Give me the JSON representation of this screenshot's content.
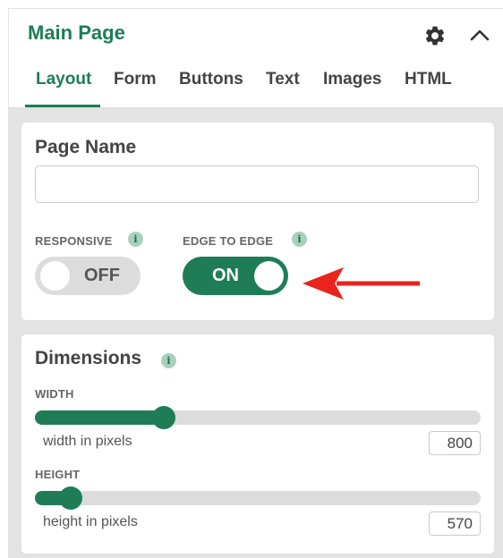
{
  "header": {
    "title": "Main Page",
    "icons": {
      "settings": "gear-icon",
      "collapse": "chevron-up-icon"
    }
  },
  "tabs": [
    {
      "label": "Layout",
      "active": true
    },
    {
      "label": "Form",
      "active": false
    },
    {
      "label": "Buttons",
      "active": false
    },
    {
      "label": "Text",
      "active": false
    },
    {
      "label": "Images",
      "active": false
    },
    {
      "label": "HTML",
      "active": false
    }
  ],
  "page_name": {
    "title": "Page Name",
    "value": "",
    "placeholder": ""
  },
  "responsive": {
    "label": "RESPONSIVE",
    "info": "i",
    "state": "OFF"
  },
  "edge_to_edge": {
    "label": "EDGE TO EDGE",
    "info": "i",
    "state": "ON"
  },
  "dimensions": {
    "title": "Dimensions",
    "info": "i",
    "width": {
      "label": "WIDTH",
      "hint": "width in pixels",
      "value": "800",
      "level": 0.29
    },
    "height": {
      "label": "HEIGHT",
      "hint": "height in pixels",
      "value": "570",
      "level": 0.08
    }
  },
  "colors": {
    "brand_green": "#1e7d56",
    "annotation_arrow": "#e8241c",
    "toggle_off": "#dcdcdc",
    "info_badge": "#a8d1bd"
  }
}
